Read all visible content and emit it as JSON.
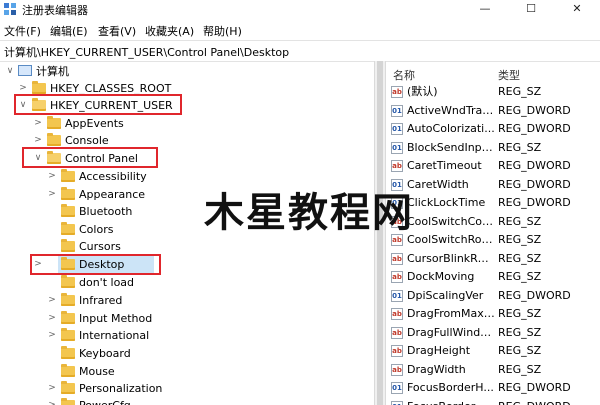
{
  "window": {
    "title": "注册表编辑器",
    "controls": {
      "minimize": "—",
      "maximize": "☐",
      "close": "✕"
    }
  },
  "menu": [
    "文件(F)",
    "编辑(E)",
    "查看(V)",
    "收藏夹(A)",
    "帮助(H)"
  ],
  "address": "计算机\\HKEY_CURRENT_USER\\Control Panel\\Desktop",
  "tree": {
    "root": "计算机",
    "items": [
      {
        "label": "HKEY_CLASSES_ROOT",
        "arrow": ">"
      },
      {
        "label": "HKEY_CURRENT_USER",
        "arrow": "∨"
      },
      {
        "label": "AppEvents",
        "arrow": ">"
      },
      {
        "label": "Console",
        "arrow": ">"
      },
      {
        "label": "Control Panel",
        "arrow": "∨"
      },
      {
        "label": "Accessibility",
        "arrow": ">"
      },
      {
        "label": "Appearance",
        "arrow": ">"
      },
      {
        "label": "Bluetooth",
        "arrow": ""
      },
      {
        "label": "Colors",
        "arrow": ""
      },
      {
        "label": "Cursors",
        "arrow": ""
      },
      {
        "label": "Desktop",
        "arrow": ">"
      },
      {
        "label": "don't load",
        "arrow": ""
      },
      {
        "label": "Infrared",
        "arrow": ">"
      },
      {
        "label": "Input Method",
        "arrow": ">"
      },
      {
        "label": "International",
        "arrow": ">"
      },
      {
        "label": "Keyboard",
        "arrow": ""
      },
      {
        "label": "Mouse",
        "arrow": ""
      },
      {
        "label": "Personalization",
        "arrow": ">"
      },
      {
        "label": "PowerCfg",
        "arrow": ">"
      }
    ]
  },
  "list": {
    "columns": {
      "name": "名称",
      "type": "类型"
    },
    "rows": [
      {
        "kind": "ab",
        "name": "(默认)",
        "type": "REG_SZ"
      },
      {
        "kind": "bin",
        "name": "ActiveWndTrac...",
        "type": "REG_DWORD"
      },
      {
        "kind": "bin",
        "name": "AutoColorizati...",
        "type": "REG_DWORD"
      },
      {
        "kind": "bin",
        "name": "BlockSendInpu...",
        "type": "REG_SZ"
      },
      {
        "kind": "ab",
        "name": "CaretTimeout",
        "type": "REG_DWORD"
      },
      {
        "kind": "bin",
        "name": "CaretWidth",
        "type": "REG_DWORD"
      },
      {
        "kind": "bin",
        "name": "ClickLockTime",
        "type": "REG_DWORD"
      },
      {
        "kind": "ab",
        "name": "CoolSwitchCol...",
        "type": "REG_SZ"
      },
      {
        "kind": "ab",
        "name": "CoolSwitchRows",
        "type": "REG_SZ"
      },
      {
        "kind": "ab",
        "name": "CursorBlinkRate",
        "type": "REG_SZ"
      },
      {
        "kind": "ab",
        "name": "DockMoving",
        "type": "REG_SZ"
      },
      {
        "kind": "bin",
        "name": "DpiScalingVer",
        "type": "REG_DWORD"
      },
      {
        "kind": "ab",
        "name": "DragFromMaxi...",
        "type": "REG_SZ"
      },
      {
        "kind": "ab",
        "name": "DragFullWindo...",
        "type": "REG_SZ"
      },
      {
        "kind": "ab",
        "name": "DragHeight",
        "type": "REG_SZ"
      },
      {
        "kind": "ab",
        "name": "DragWidth",
        "type": "REG_SZ"
      },
      {
        "kind": "bin",
        "name": "FocusBorderH...",
        "type": "REG_DWORD"
      },
      {
        "kind": "bin",
        "name": "FocusBorderW...",
        "type": "REG_DWORD"
      }
    ]
  },
  "watermark": "木星教程网",
  "colors": {
    "highlight": "#e0262c",
    "selection": "#cce4f7",
    "folder": "#f3c64f"
  }
}
